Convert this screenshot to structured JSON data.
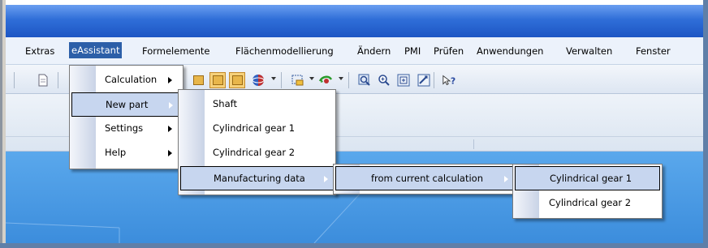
{
  "menubar": {
    "items": [
      {
        "label": "Extras"
      },
      {
        "label": "eAssistant"
      },
      {
        "label": "Formelemente"
      },
      {
        "label": "Flächenmodellierung"
      },
      {
        "label": "Ändern"
      },
      {
        "label": "PMI"
      },
      {
        "label": "Prüfen"
      },
      {
        "label": "Anwendungen"
      },
      {
        "label": "Verwalten"
      },
      {
        "label": "Fenster"
      }
    ],
    "active_index": 1
  },
  "eassistant_menu": {
    "items": [
      {
        "label": "Calculation",
        "has_submenu": true
      },
      {
        "label": "New part",
        "has_submenu": true,
        "highlighted": true
      },
      {
        "label": "Settings",
        "has_submenu": true
      },
      {
        "label": "Help",
        "has_submenu": true
      }
    ]
  },
  "new_part_menu": {
    "items": [
      {
        "label": "Shaft"
      },
      {
        "label": "Cylindrical gear 1"
      },
      {
        "label": "Cylindrical gear 2"
      },
      {
        "label": "Manufacturing data",
        "has_submenu": true,
        "highlighted": true
      }
    ]
  },
  "manufacturing_menu": {
    "items": [
      {
        "label": "from current calculation",
        "has_submenu": true,
        "highlighted": true
      }
    ]
  },
  "calculation_menu": {
    "items": [
      {
        "label": "Cylindrical gear 1",
        "highlighted": true
      },
      {
        "label": "Cylindrical gear 2"
      }
    ]
  },
  "toolbar": {
    "icons": [
      "new-file-icon",
      "part-cube-icon",
      "part-cube-pressed-icon",
      "part-cube-pressed-icon",
      "sphere-icon",
      "select-icon",
      "orbit-icon",
      "zoom-area-icon",
      "zoom-icon",
      "zoom-fit-icon",
      "view-icon",
      "help-pointer-icon"
    ]
  },
  "colors": {
    "titlebar": "#2f6ed8",
    "menu_active": "#2c5fa8",
    "highlight": "#c7d6ef",
    "viewport": "#4a9be4"
  }
}
